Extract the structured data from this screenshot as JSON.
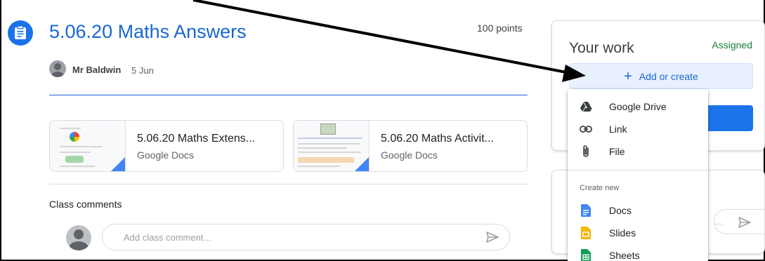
{
  "assignment": {
    "title": "5.06.20 Maths Answers",
    "points": "100 points",
    "author": "Mr Baldwin",
    "date": "5 Jun"
  },
  "attachments": [
    {
      "title": "5.06.20 Maths Extens...",
      "type": "Google Docs"
    },
    {
      "title": "5.06.20 Maths Activit...",
      "type": "Google Docs"
    }
  ],
  "comments": {
    "label": "Class comments",
    "placeholder": "Add class comment..."
  },
  "your_work": {
    "title": "Your work",
    "status": "Assigned",
    "add_label": "Add or create"
  },
  "menu": {
    "items": [
      {
        "label": "Google Drive",
        "icon": "google-drive-icon"
      },
      {
        "label": "Link",
        "icon": "link-icon"
      },
      {
        "label": "File",
        "icon": "paperclip-icon"
      }
    ],
    "section_label": "Create new",
    "create_items": [
      {
        "label": "Docs",
        "icon": "docs-icon",
        "color": "#4285f4"
      },
      {
        "label": "Slides",
        "icon": "slides-icon",
        "color": "#f4b400"
      },
      {
        "label": "Sheets",
        "icon": "sheets-icon",
        "color": "#0f9d58"
      }
    ]
  },
  "colors": {
    "accent": "#1967d2",
    "status_assigned": "#188038",
    "primary_button": "#1a73e8"
  }
}
